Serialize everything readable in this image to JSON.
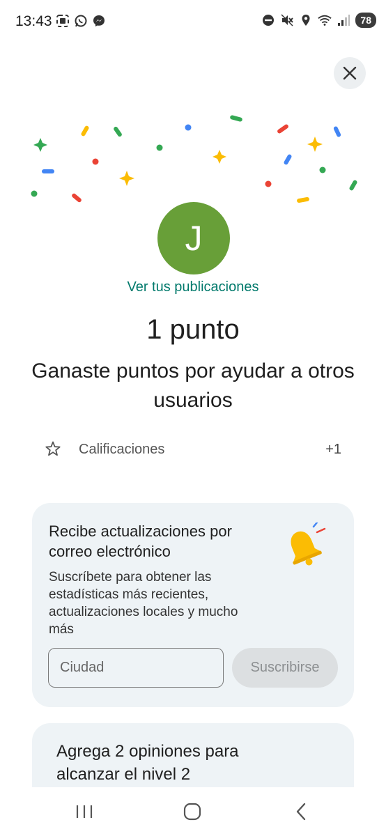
{
  "status_bar": {
    "time": "13:43",
    "left_icons": [
      "screenshot-icon",
      "whatsapp-icon",
      "messenger-icon"
    ],
    "right_icons": [
      "do-not-disturb-icon",
      "mute-icon",
      "location-icon",
      "wifi-icon",
      "signal-icon"
    ],
    "battery": "78"
  },
  "profile": {
    "initial": "J",
    "avatar_color": "#689f38",
    "view_posts_label": "Ver tus publicaciones"
  },
  "points": {
    "title": "1 punto",
    "description": "Ganaste puntos por ayudar a otros usuarios"
  },
  "ratings": {
    "label": "Calificaciones",
    "value": "+1"
  },
  "email_card": {
    "title": "Recibe actualizaciones por correo electrónico",
    "body": "Suscríbete para obtener las estadísticas más recientes, actualizaciones locales y mucho más",
    "city_placeholder": "Ciudad",
    "subscribe_label": "Suscribirse"
  },
  "level_card": {
    "title": "Agrega 2 opiniones para alcanzar el nivel 2"
  },
  "colors": {
    "accent_teal": "#00796b",
    "card_bg": "#eef3f6",
    "confetti": [
      "#34a853",
      "#fbbc04",
      "#ea4335",
      "#4285f4"
    ]
  }
}
